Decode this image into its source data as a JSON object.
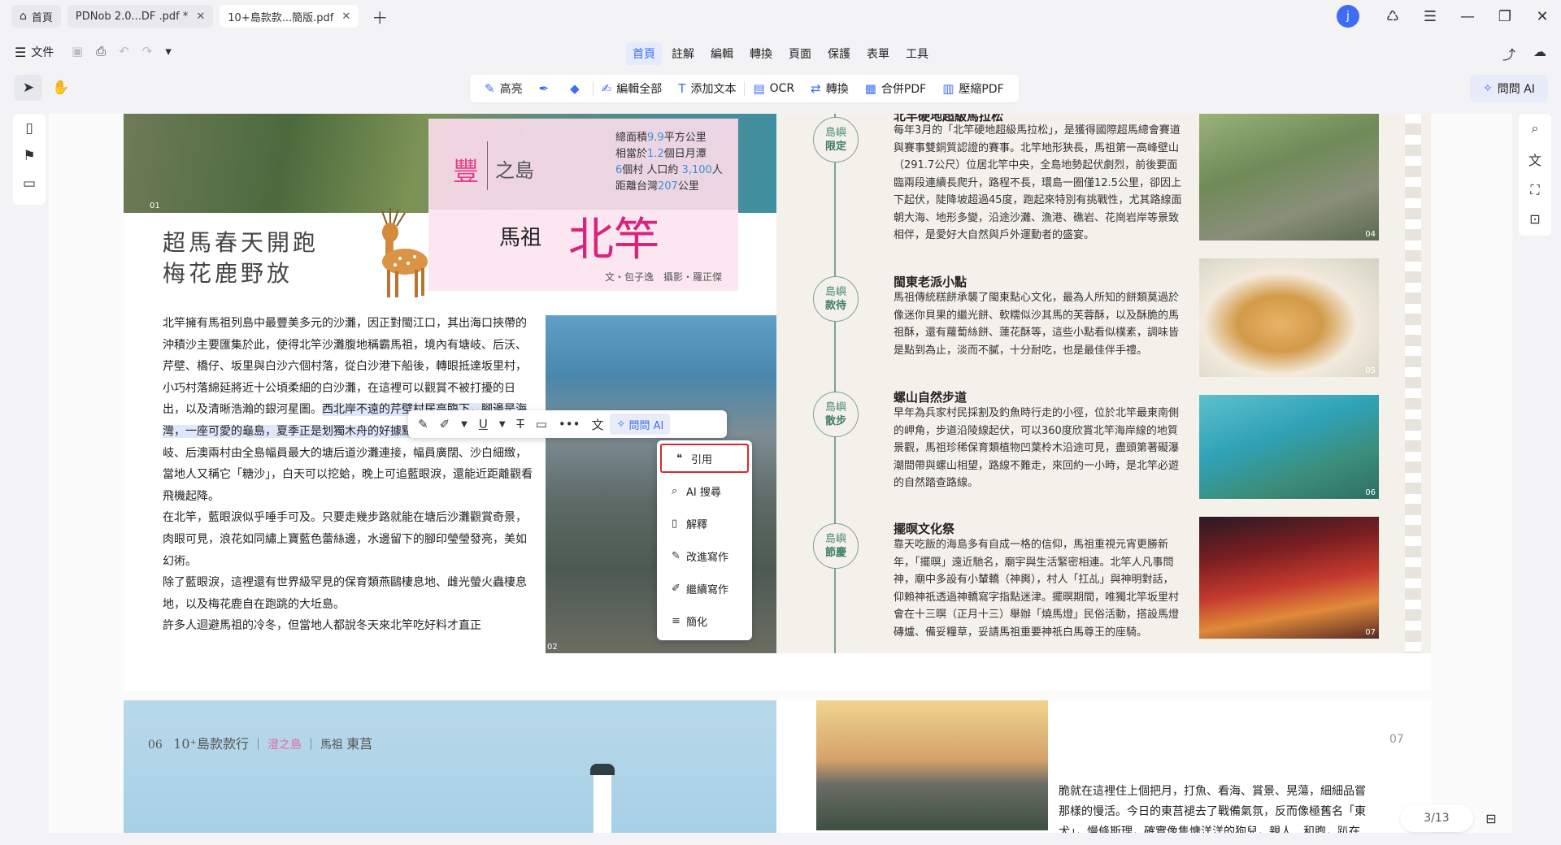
{
  "tabs": [
    {
      "label": "首頁",
      "active": false
    },
    {
      "label": "PDNob 2.0...DF .pdf *",
      "active": false
    },
    {
      "label": "10+島款款...簡版.pdf",
      "active": true
    }
  ],
  "window": {
    "avatar_letter": "j"
  },
  "menu": {
    "file": "文件",
    "items": [
      "首頁",
      "註解",
      "編輯",
      "轉換",
      "頁面",
      "保護",
      "表單",
      "工具"
    ],
    "active": "首頁"
  },
  "toolbar": {
    "highlight": "高亮",
    "edit_all": "編輯全部",
    "add_text": "添加文本",
    "ocr": "OCR",
    "convert": "轉換",
    "merge": "合併PDF",
    "compress": "壓縮PDF",
    "ask_ai": "問問 AI"
  },
  "page_left": {
    "photo_number": "01",
    "island_char": "豐",
    "island_suffix": "之島",
    "stats": [
      "總面積 9.9 平方公里",
      "相當於 1.2 個日月潭",
      "6 個村 人口約 3,100 人",
      "距離台灣 207 公里"
    ],
    "stat_parts": [
      [
        "總面積",
        "9.9",
        "平方公里"
      ],
      [
        "相當於",
        "1.2",
        "個日月潭"
      ],
      [
        "",
        "6",
        "個村 人口約 ",
        "3,100",
        "人"
      ],
      [
        "距離台灣",
        "207",
        "公里"
      ]
    ],
    "region": "馬祖",
    "place": "北竿",
    "credit": "文・包子逸　攝影・羅正傑",
    "headline_1": "超馬春天開跑",
    "headline_2": "梅花鹿野放",
    "paragraph_1_a": "北竿擁有馬祖列島中最豐美多元的沙灘，因正對閩江口，其出海口挾帶的沖積沙主要匯集於此，使得北竿沙灘腹地稱霸馬祖，境內有塘岐、后沃、芹壁、橋仔、坂里與白沙六個村落，從白沙港下船後，轉眼抵達坂里村，小巧村落綿延將近十公頃柔細的白沙灘，在這裡可以觀賞不被打擾的日出，以及清晰浩瀚的銀河星圖。",
    "paragraph_1_hl": "西北岸不遠的芹壁村居高臨下，腳邊是海灣，",
    "paragraph_1_hl2": "一座可愛的龜島，夏季正是划獨木舟的好據點",
    "paragraph_1_b": "。翻過山頭，東側的塘岐、后澳兩村由全島幅員最大的塘后道沙灘連接，幅員廣闊、沙白細緻，當地人又稱它「糖沙」，白天可以挖蛤，晚上可追藍眼淚，還能近距離觀看飛機起降。",
    "paragraph_2": "在北竿，藍眼淚似乎唾手可及。只要走幾步路就能在塘后沙灘觀賞奇景，肉眼可見，浪花如同繡上寶藍色蕾絲邊，水邊留下的腳印瑩瑩發亮，美如幻術。",
    "paragraph_3": "除了藍眼淚，這裡還有世界級罕見的保育類燕鷗棲息地、雌光螢火蟲棲息地，以及梅花鹿自在跑跳的大坵島。",
    "paragraph_4": "許多人迴避馬祖的冷冬，但當地人都說冬天來北竿吃好料才直正",
    "photo2_number": "02"
  },
  "page_right": {
    "sections": [
      {
        "badge_top": "島嶼",
        "badge_bottom": "限定",
        "title": "北竿硬地超級馬拉松",
        "body": "每年3月的「北竿硬地超級馬拉松」，是獲得國際超馬總會賽道與賽事雙銅質認證的賽事。北竿地形狹長，馬祖第一高峰壁山（291.7公尺）位居北竿中央，全島地勢起伏劇烈，前後要面臨兩段連續長爬升，路程不長，環島一圈僅12.5公里，卻因上下起伏，陡降坡超過45度，跑起來特別有挑戰性，尤其路線面朝大海、地形多變，沿途沙灘、漁港、礁岩、花崗岩岸等景致相伴，是愛好大自然與戶外運動者的盛宴。",
        "photo_number": "04"
      },
      {
        "badge_top": "島嶼",
        "badge_bottom": "款待",
        "title": "閩東老派小點",
        "body": "馬祖傳統糕餅承襲了閩東點心文化，最為人所知的餅類莫過於像迷你貝果的繼光餅、軟糯似沙其馬的芙蓉酥，以及酥脆的馬祖酥，還有蘿蔔絲餅、蓮花酥等，這些小點看似樸素，調味皆是點到為止，淡而不膩，十分耐吃，也是最佳伴手禮。",
        "photo_number": "05"
      },
      {
        "badge_top": "島嶼",
        "badge_bottom": "散步",
        "title": "螺山自然步道",
        "body": "早年為兵家村民採割及釣魚時行走的小徑，位於北竿最東南側的岬角，步道沿陵線起伏，可以360度欣賞北竿海岸線的地質景觀，馬祖珍稀保育類植物凹葉柃木沿途可見，盡頭第著礙瀑潮間帶與螺山相望，路線不難走，來回約一小時，是北竿必遊的自然踏查路線。",
        "photo_number": "06"
      },
      {
        "badge_top": "島嶼",
        "badge_bottom": "節慶",
        "title": "擺暝文化祭",
        "body": "靠天吃飯的海島多有自成一格的信仰，馬祖重視元宵更勝新年，「擺暝」遠近馳名，廟宇與生活緊密相連。北竿人凡事問神，廟中多設有小輦轎（神輿），村人「扛乩」與神明對話，仰賴神祇透過神轎寫字指點迷津。擺暝期間，唯獨北竿坂里村會在十三暝（正月十三）舉辦「燒馬燈」民俗活動，搭設馬燈磚爐、備妥糧草，妥請馬祖重要神祇白馬尊王的座騎。",
        "photo_number": "07"
      }
    ]
  },
  "spread2": {
    "page_number_left": "06",
    "running_brand": "10⁺島款款行",
    "running_sep": "｜",
    "running_island": "澄之島",
    "running_region": "馬祖",
    "running_place": "東莒",
    "page_number_right": "07",
    "text": "脆就在這裡住上個把月，打魚、看海、賞景、晃蕩，細細品嘗那樣的慢活。今日的東莒褪去了戰備氣氛，反而像極舊名「東犬」，慢條斯理，確實像隻慵洋洋的狗兒，親人、和煦，趴在"
  },
  "selection_toolbar": {
    "ask_ai": "問問 AI"
  },
  "ai_menu": {
    "items": [
      "引用",
      "AI 搜尋",
      "解釋",
      "改進寫作",
      "繼續寫作",
      "簡化"
    ],
    "highlighted": "引用"
  },
  "page_indicator": "3/13",
  "colors": {
    "accent": "#3d6df5",
    "pink_title": "#d8257c",
    "teal": "#7aa292",
    "red_box": "#d92b2b"
  }
}
